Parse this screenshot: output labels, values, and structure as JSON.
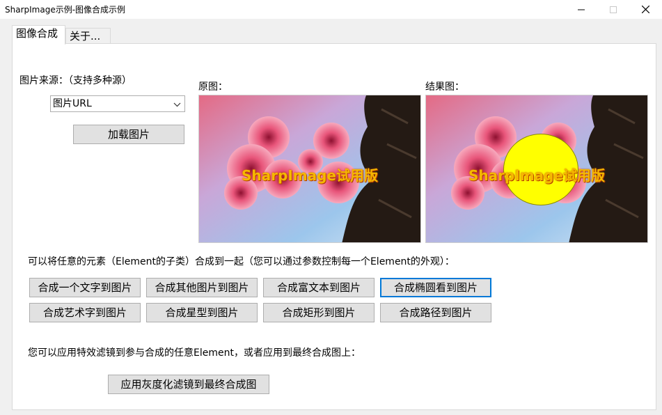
{
  "window": {
    "title": "SharpImage示例-图像合成示例"
  },
  "tabs": [
    {
      "label": "图像合成"
    },
    {
      "label": "关于..."
    }
  ],
  "source": {
    "label": "图片来源：（支持多种源）",
    "select_value": "图片URL",
    "load_button": "加载图片"
  },
  "images": {
    "original_label": "原图：",
    "result_label": "结果图：",
    "watermark": "SharpImage试用版"
  },
  "composite": {
    "description": "可以将任意的元素（Element的子类）合成到一起（您可以通过参数控制每一个Element的外观）：",
    "buttons": [
      "合成一个文字到图片",
      "合成其他图片到图片",
      "合成富文本到图片",
      "合成椭圆看到图片",
      "合成艺术字到图片",
      "合成星型到图片",
      "合成矩形到图片",
      "合成路径到图片"
    ]
  },
  "filter": {
    "description": "您可以应用特效滤镜到参与合成的任意Element，或者应用到最终合成图上：",
    "button": "应用灰度化滤镜到最终合成图"
  }
}
